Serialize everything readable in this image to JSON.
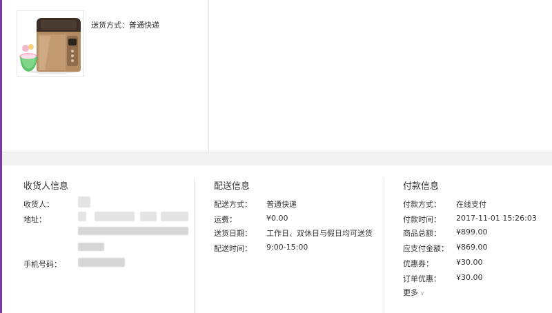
{
  "product": {
    "image_name": "bread-maker-product-image",
    "shipping_label": "送货方式：",
    "shipping_value": "普通快递"
  },
  "receiver": {
    "title": "收货人信息",
    "name_label": "收货人：",
    "address_label": "地址：",
    "phone_label": "手机号码："
  },
  "delivery": {
    "title": "配送信息",
    "rows": [
      {
        "label": "配送方式：",
        "value": "普通快递"
      },
      {
        "label": "运费：",
        "value": "¥0.00"
      },
      {
        "label": "送货日期：",
        "value": "工作日、双休日与假日均可送货"
      },
      {
        "label": "配送时间：",
        "value": "9:00-15:00"
      }
    ]
  },
  "payment": {
    "title": "付款信息",
    "rows": [
      {
        "label": "付款方式：",
        "value": "在线支付"
      },
      {
        "label": "付款时间：",
        "value": "2017-11-01 15:26:03"
      },
      {
        "label": "商品总额：",
        "value": "¥899.00"
      },
      {
        "label": "应支付金额：",
        "value": "¥869.00"
      },
      {
        "label": "优惠券：",
        "value": "¥30.00"
      },
      {
        "label": "订单优惠：",
        "value": "¥30.00"
      }
    ],
    "more_label": "更多"
  },
  "colors": {
    "accent_rule": "#7b3aa8",
    "band": "#f2f2f2"
  }
}
